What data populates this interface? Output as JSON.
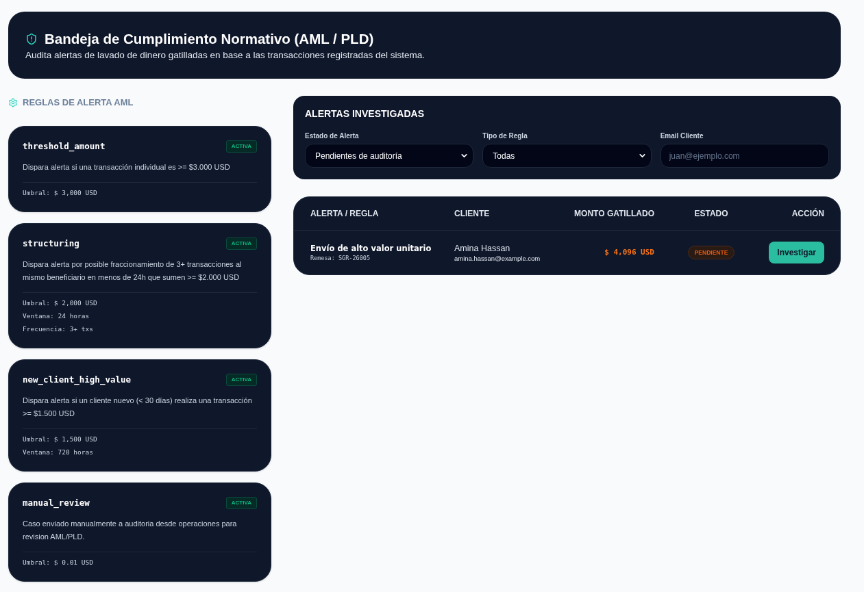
{
  "header": {
    "title": "Bandeja de Cumplimiento Normativo (AML / PLD)",
    "subtitle": "Audita alertas de lavado de dinero gatilladas en base a las transacciones registradas del sistema."
  },
  "rules_section": {
    "title": "REGLAS DE ALERTA AML",
    "rules": [
      {
        "name": "threshold_amount",
        "status": "ACTIVA",
        "active": true,
        "description": "Dispara alerta si una transacción individual es >= $3.000 USD",
        "params": [
          "Umbral: $ 3,000 USD"
        ]
      },
      {
        "name": "structuring",
        "status": "ACTIVA",
        "active": true,
        "description": "Dispara alerta por posible fraccionamiento de 3+ transacciones al mismo beneficiario en menos de 24h que sumen >= $2.000 USD",
        "params": [
          "Umbral: $ 2,000 USD",
          "Ventana: 24 horas",
          "Frecuencia: 3+ txs"
        ]
      },
      {
        "name": "new_client_high_value",
        "status": "ACTIVA",
        "active": true,
        "description": "Dispara alerta si un cliente nuevo (< 30 días) realiza una transacción >= $1.500 USD",
        "params": [
          "Umbral: $ 1,500 USD",
          "Ventana: 720 horas"
        ]
      },
      {
        "name": "manual_review",
        "status": "ACTIVA",
        "active": true,
        "description": "Caso enviado manualmente a auditoria desde operaciones para revision AML/PLD.",
        "params": [
          "Umbral: $ 0.01 USD"
        ]
      }
    ]
  },
  "filters": {
    "title": "ALERTAS INVESTIGADAS",
    "fields": [
      {
        "kind": "select",
        "label": "Estado de Alerta",
        "value": "Pendientes de auditoría"
      },
      {
        "kind": "select",
        "label": "Tipo de Regla",
        "value": "Todas"
      },
      {
        "kind": "input",
        "label": "Email Cliente",
        "placeholder": "juan@ejemplo.com"
      }
    ]
  },
  "alerts_table": {
    "columns": [
      "ALERTA / REGLA",
      "CLIENTE",
      "MONTO GATILLADO",
      "ESTADO",
      "ACCIÓN"
    ],
    "rows": [
      {
        "alert": "Envío de alto valor unitario",
        "reference": "Remesa: SGR-26005",
        "client_name": "Amina Hassan",
        "client_email": "amina.hassan@example.com",
        "amount": "$ 4,096 USD",
        "status": "PENDIENTE",
        "action": "Investigar"
      }
    ]
  }
}
